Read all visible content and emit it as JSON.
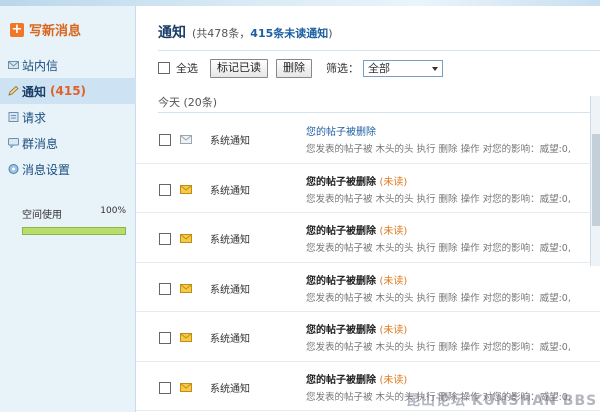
{
  "sidebar": {
    "compose_label": "写新消息",
    "items": [
      {
        "label": "站内信",
        "count": "",
        "icon": "mail-icon",
        "active": false
      },
      {
        "label": "通知",
        "count": "(415)",
        "icon": "pencil-icon",
        "active": true
      },
      {
        "label": "请求",
        "count": "",
        "icon": "request-icon",
        "active": false
      },
      {
        "label": "群消息",
        "count": "",
        "icon": "group-message-icon",
        "active": false
      },
      {
        "label": "消息设置",
        "count": "",
        "icon": "settings-icon",
        "active": false
      }
    ],
    "space": {
      "label": "空间使用",
      "percent_label": "100%",
      "fraction": 1.0
    }
  },
  "main": {
    "title": "通知",
    "summary_prefix": "(共478条，",
    "summary_unread": "415条未读通知",
    "summary_suffix": ")",
    "toolbar": {
      "select_all_label": "全选",
      "mark_read_label": "标记已读",
      "delete_label": "删除",
      "filter_label": "筛选：",
      "filter_value": "全部"
    },
    "section_label": "今天 (20条)",
    "rows": [
      {
        "sender": "系统通知",
        "subject": "您的帖子被删除",
        "status": "",
        "preview": "您发表的帖子被 木头的头 执行 删除 操作 对您的影响：威望:0,",
        "read": true
      },
      {
        "sender": "系统通知",
        "subject": "您的帖子被删除",
        "status": "(未读)",
        "preview": "您发表的帖子被 木头的头 执行 删除 操作 对您的影响：威望:0,",
        "read": false
      },
      {
        "sender": "系统通知",
        "subject": "您的帖子被删除",
        "status": "(未读)",
        "preview": "您发表的帖子被 木头的头 执行 删除 操作 对您的影响：威望:0,",
        "read": false
      },
      {
        "sender": "系统通知",
        "subject": "您的帖子被删除",
        "status": "(未读)",
        "preview": "您发表的帖子被 木头的头 执行 删除 操作 对您的影响：威望:0,",
        "read": false
      },
      {
        "sender": "系统通知",
        "subject": "您的帖子被删除",
        "status": "(未读)",
        "preview": "您发表的帖子被 木头的头 执行 删除 操作 对您的影响：威望:0,",
        "read": false
      },
      {
        "sender": "系统通知",
        "subject": "您的帖子被删除",
        "status": "(未读)",
        "preview": "您发表的帖子被 木头的头 执行 删除 操作 对您的影响：威望:0,",
        "read": false
      }
    ]
  },
  "watermark": "昆山论坛 KUNSHAN BBS",
  "colors": {
    "accent": "#e07a1f",
    "link": "#1c5fa2",
    "sidebar_bg": "#e8f2f9",
    "active_bg": "#cde2f2"
  }
}
